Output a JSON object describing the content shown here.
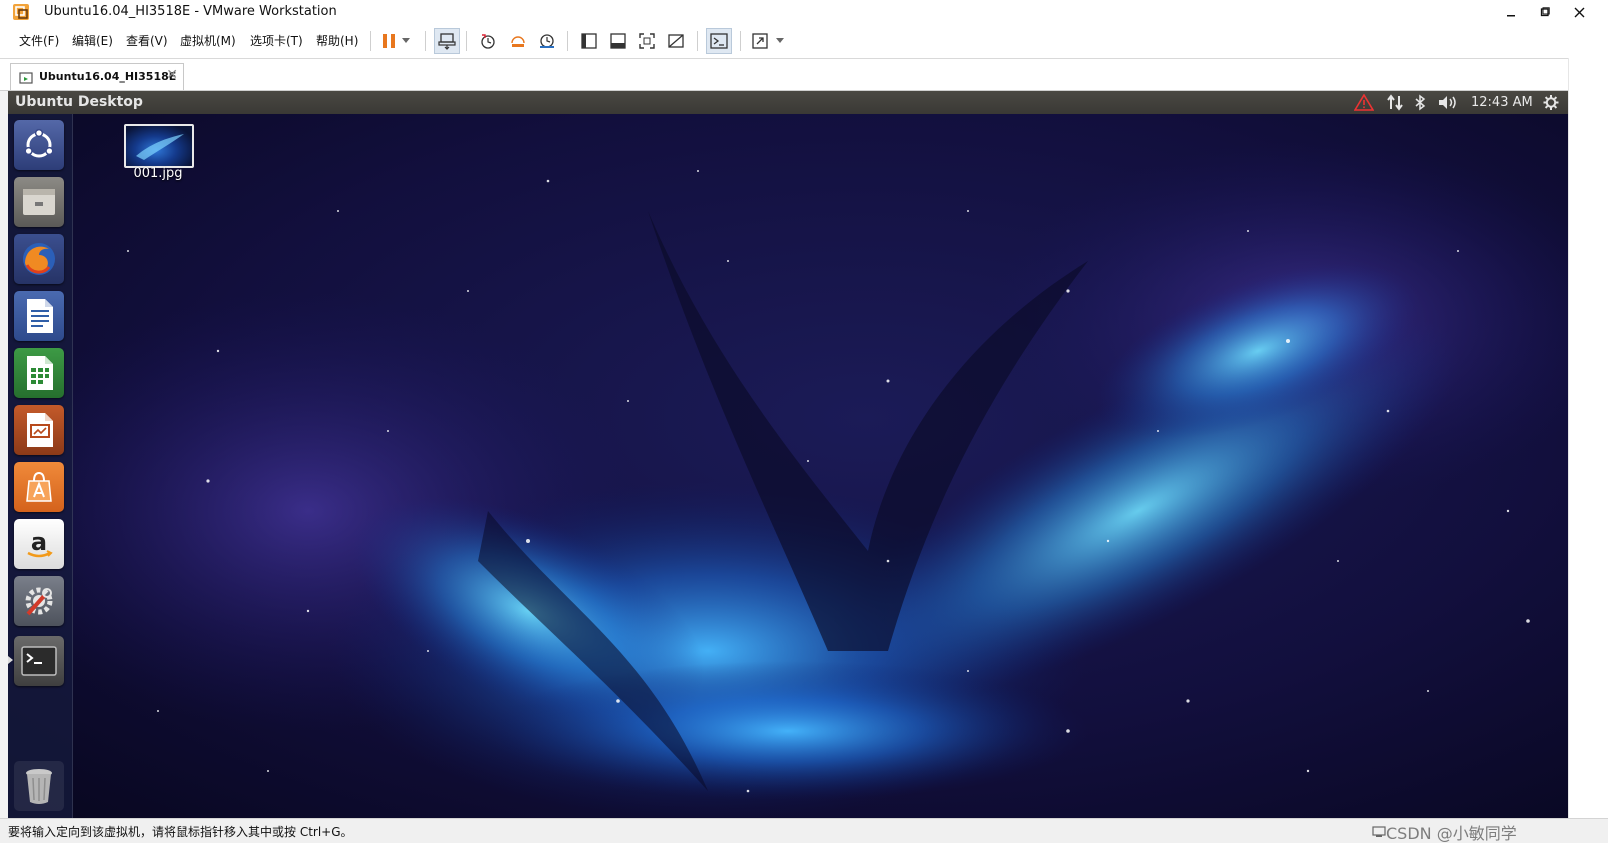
{
  "window": {
    "title": "Ubuntu16.04_HI3518E - VMware Workstation"
  },
  "menu": [
    "文件(F)",
    "编辑(E)",
    "查看(V)",
    "虚拟机(M)",
    "选项卡(T)",
    "帮助(H)"
  ],
  "tab": {
    "label": "Ubuntu16.04_HI3518E"
  },
  "ubuntu": {
    "panel_title": "Ubuntu Desktop",
    "clock": "12:43 AM",
    "launcher": [
      "ubuntu-dash",
      "files",
      "firefox",
      "libreoffice-writer",
      "libreoffice-calc",
      "libreoffice-impress",
      "software-center",
      "amazon",
      "system-settings",
      "terminal",
      "trash"
    ],
    "desktop_file": "001.jpg"
  },
  "status": {
    "text": "要将输入定向到该虚拟机，请将鼠标指针移入其中或按 Ctrl+G。",
    "watermark": "CSDN @小敏同学"
  },
  "colors": {
    "pause": "#e8771e",
    "panel": "#3d3b37",
    "accent": "#2f78d8"
  }
}
